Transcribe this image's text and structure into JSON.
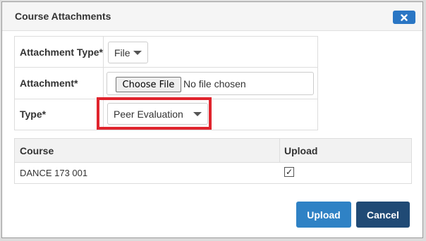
{
  "modal": {
    "title": "Course Attachments",
    "close_icon": "close-icon",
    "accent": "#2a76c4"
  },
  "form": {
    "attachment_type_label": "Attachment Type*",
    "attachment_type_value": "File",
    "attachment_label": "Attachment*",
    "choose_file_label": "Choose File",
    "file_status": "No file chosen",
    "type_label": "Type*",
    "type_value": "Peer Evaluation"
  },
  "courses": {
    "headers": [
      "Course",
      "Upload"
    ],
    "rows": [
      {
        "course": "DANCE 173 001",
        "upload_checked": true
      }
    ]
  },
  "footer": {
    "upload_label": "Upload",
    "cancel_label": "Cancel"
  }
}
